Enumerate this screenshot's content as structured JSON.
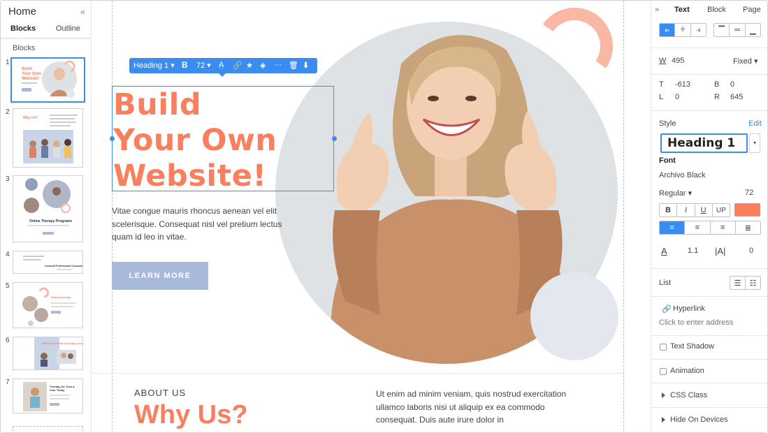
{
  "left_panel": {
    "title": "Home",
    "collapse_icon": "double-chevron-left-icon",
    "tabs": [
      {
        "label": "Blocks",
        "active": true
      },
      {
        "label": "Outline",
        "active": false
      }
    ],
    "section_label": "Blocks",
    "thumbnails": [
      {
        "num": "1",
        "selected": true,
        "text": "Build Your Own Website!"
      },
      {
        "num": "2",
        "selected": false,
        "text": "Why Us?"
      },
      {
        "num": "3",
        "selected": false,
        "text": "Online Therapy Programs"
      },
      {
        "num": "4",
        "selected": false,
        "text": "Licensed Professional Counselors"
      },
      {
        "num": "5",
        "selected": false,
        "text": "Family therapy"
      },
      {
        "num": "6",
        "selected": false,
        "text": "What to expect at a therapy session"
      },
      {
        "num": "7",
        "selected": false,
        "text": "Therapy for Teen a Your Today"
      }
    ]
  },
  "toolbar": {
    "style": "Heading 1",
    "bold": "B",
    "size": "72",
    "icons": [
      "text-color-icon",
      "link-icon",
      "star-icon",
      "eraser-icon",
      "more-icon",
      "delete-icon",
      "move-down-icon"
    ]
  },
  "canvas": {
    "headline": [
      "Build",
      "Your Own",
      "Website!"
    ],
    "body": "Vitae congue mauris rhoncus aenean vel elit scelerisque. Consequat nisl vel pretium lectus quam id leo in vitae.",
    "button": "LEARN MORE",
    "about_label": "ABOUT US",
    "why_title": "Why Us?",
    "col2_text": "Ut enim ad minim veniam, quis nostrud exercitation ullamco laboris nisi ut aliquip ex ea commodo consequat. Duis aute irure dolor in",
    "accent_color": "#f9805f",
    "button_color": "#a9b9dc"
  },
  "right_panel": {
    "expand_icon": "double-chevron-right-icon",
    "tabs": [
      {
        "label": "Text",
        "active": true
      },
      {
        "label": "Block",
        "active": false
      },
      {
        "label": "Page",
        "active": false
      }
    ],
    "width_label": "W",
    "width_value": "495",
    "width_mode": "Fixed",
    "t_label": "T",
    "t_value": "-613",
    "b_label": "B",
    "b_value": "0",
    "l_label": "L",
    "l_value": "0",
    "r_label": "R",
    "r_value": "645",
    "style_label": "Style",
    "edit_label": "Edit",
    "style_value": "Heading 1",
    "font_label": "Font",
    "font_value": "Archivo Black",
    "weight_value": "Regular",
    "font_size": "72",
    "format_buttons": [
      "B",
      "I",
      "U",
      "UP"
    ],
    "color_swatch": "#f9805f",
    "line_height": "1.1",
    "letter_spacing": "0",
    "list_label": "List",
    "hyperlink_label": "Hyperlink",
    "hyperlink_placeholder": "Click to enter address",
    "text_shadow_label": "Text Shadow",
    "animation_label": "Animation",
    "css_class_label": "CSS Class",
    "hide_devices_label": "Hide On Devices"
  }
}
